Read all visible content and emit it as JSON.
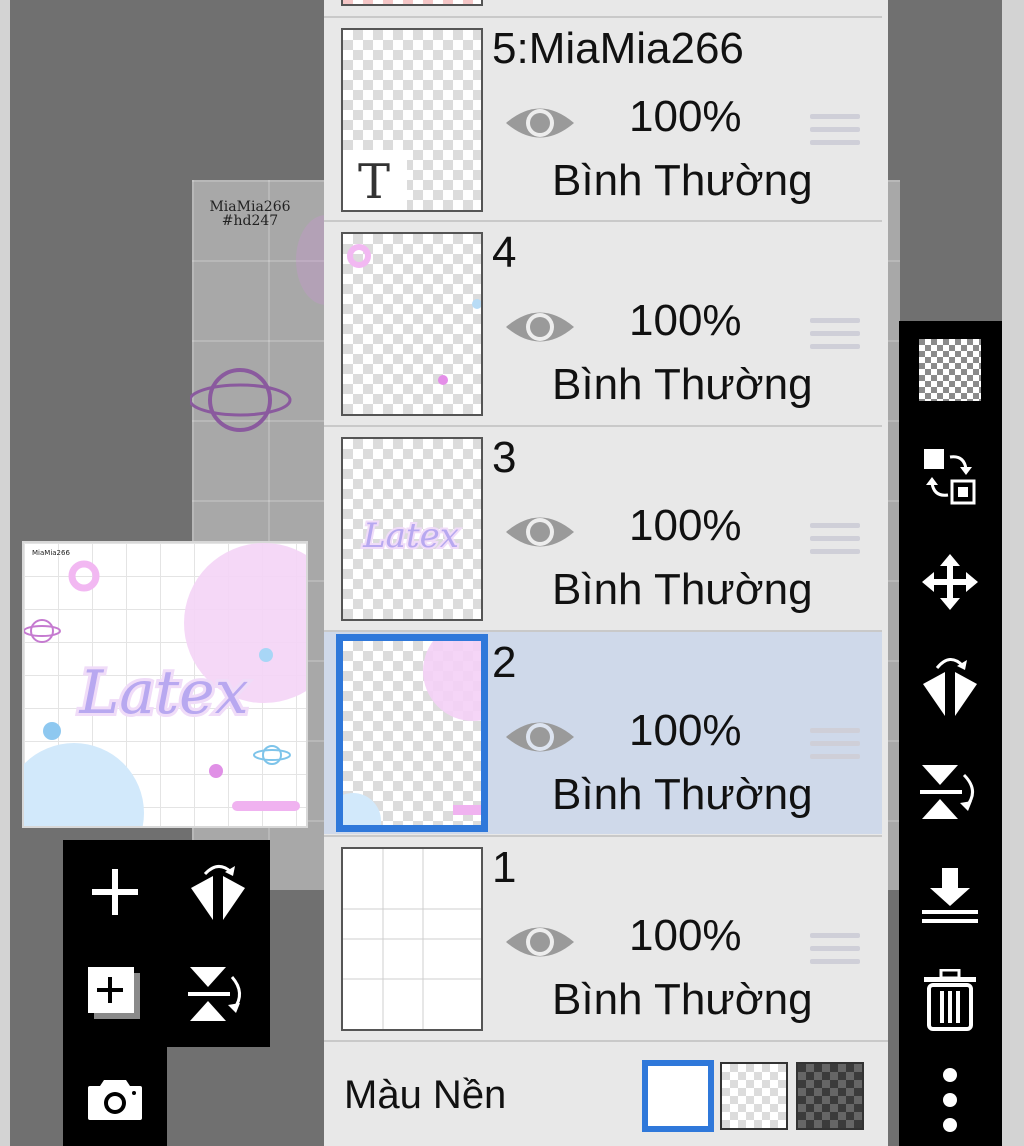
{
  "canvas": {
    "signature_line1": "MiaMia266",
    "signature_line2": "#hd247"
  },
  "preview": {
    "title_text": "Latex"
  },
  "layers": [
    {
      "name": "5:MiaMia266",
      "opacity": "100%",
      "blend_mode": "Bình Thường",
      "visible": true,
      "selected": false,
      "thumb_icon": "text-layer-icon"
    },
    {
      "name": "4",
      "opacity": "100%",
      "blend_mode": "Bình Thường",
      "visible": true,
      "selected": false
    },
    {
      "name": "3",
      "opacity": "100%",
      "blend_mode": "Bình Thường",
      "visible": true,
      "selected": false
    },
    {
      "name": "2",
      "opacity": "100%",
      "blend_mode": "Bình Thường",
      "visible": true,
      "selected": true
    },
    {
      "name": "1",
      "opacity": "100%",
      "blend_mode": "Bình Thường",
      "visible": true,
      "selected": false
    }
  ],
  "background_color": {
    "label": "Màu Nền",
    "options": [
      "white",
      "transparent",
      "dark-checker"
    ],
    "selected": "white"
  },
  "right_toolbar": {
    "tools": [
      "checkerboard-icon",
      "swap-icon",
      "move-icon",
      "flip-horizontal-icon",
      "flip-vertical-icon",
      "merge-down-icon",
      "trash-icon",
      "more-icon"
    ]
  },
  "bottom_toolbar": {
    "tools": [
      "add-layer-icon",
      "flip-layer-horizontal-icon",
      "add-canvas-icon",
      "flip-layer-vertical-icon",
      "camera-icon"
    ]
  },
  "colors": {
    "accent": "#2f78da",
    "selected_row": "#cfd9ea",
    "panel": "#e8e8e8",
    "toolbar": "#000000"
  }
}
